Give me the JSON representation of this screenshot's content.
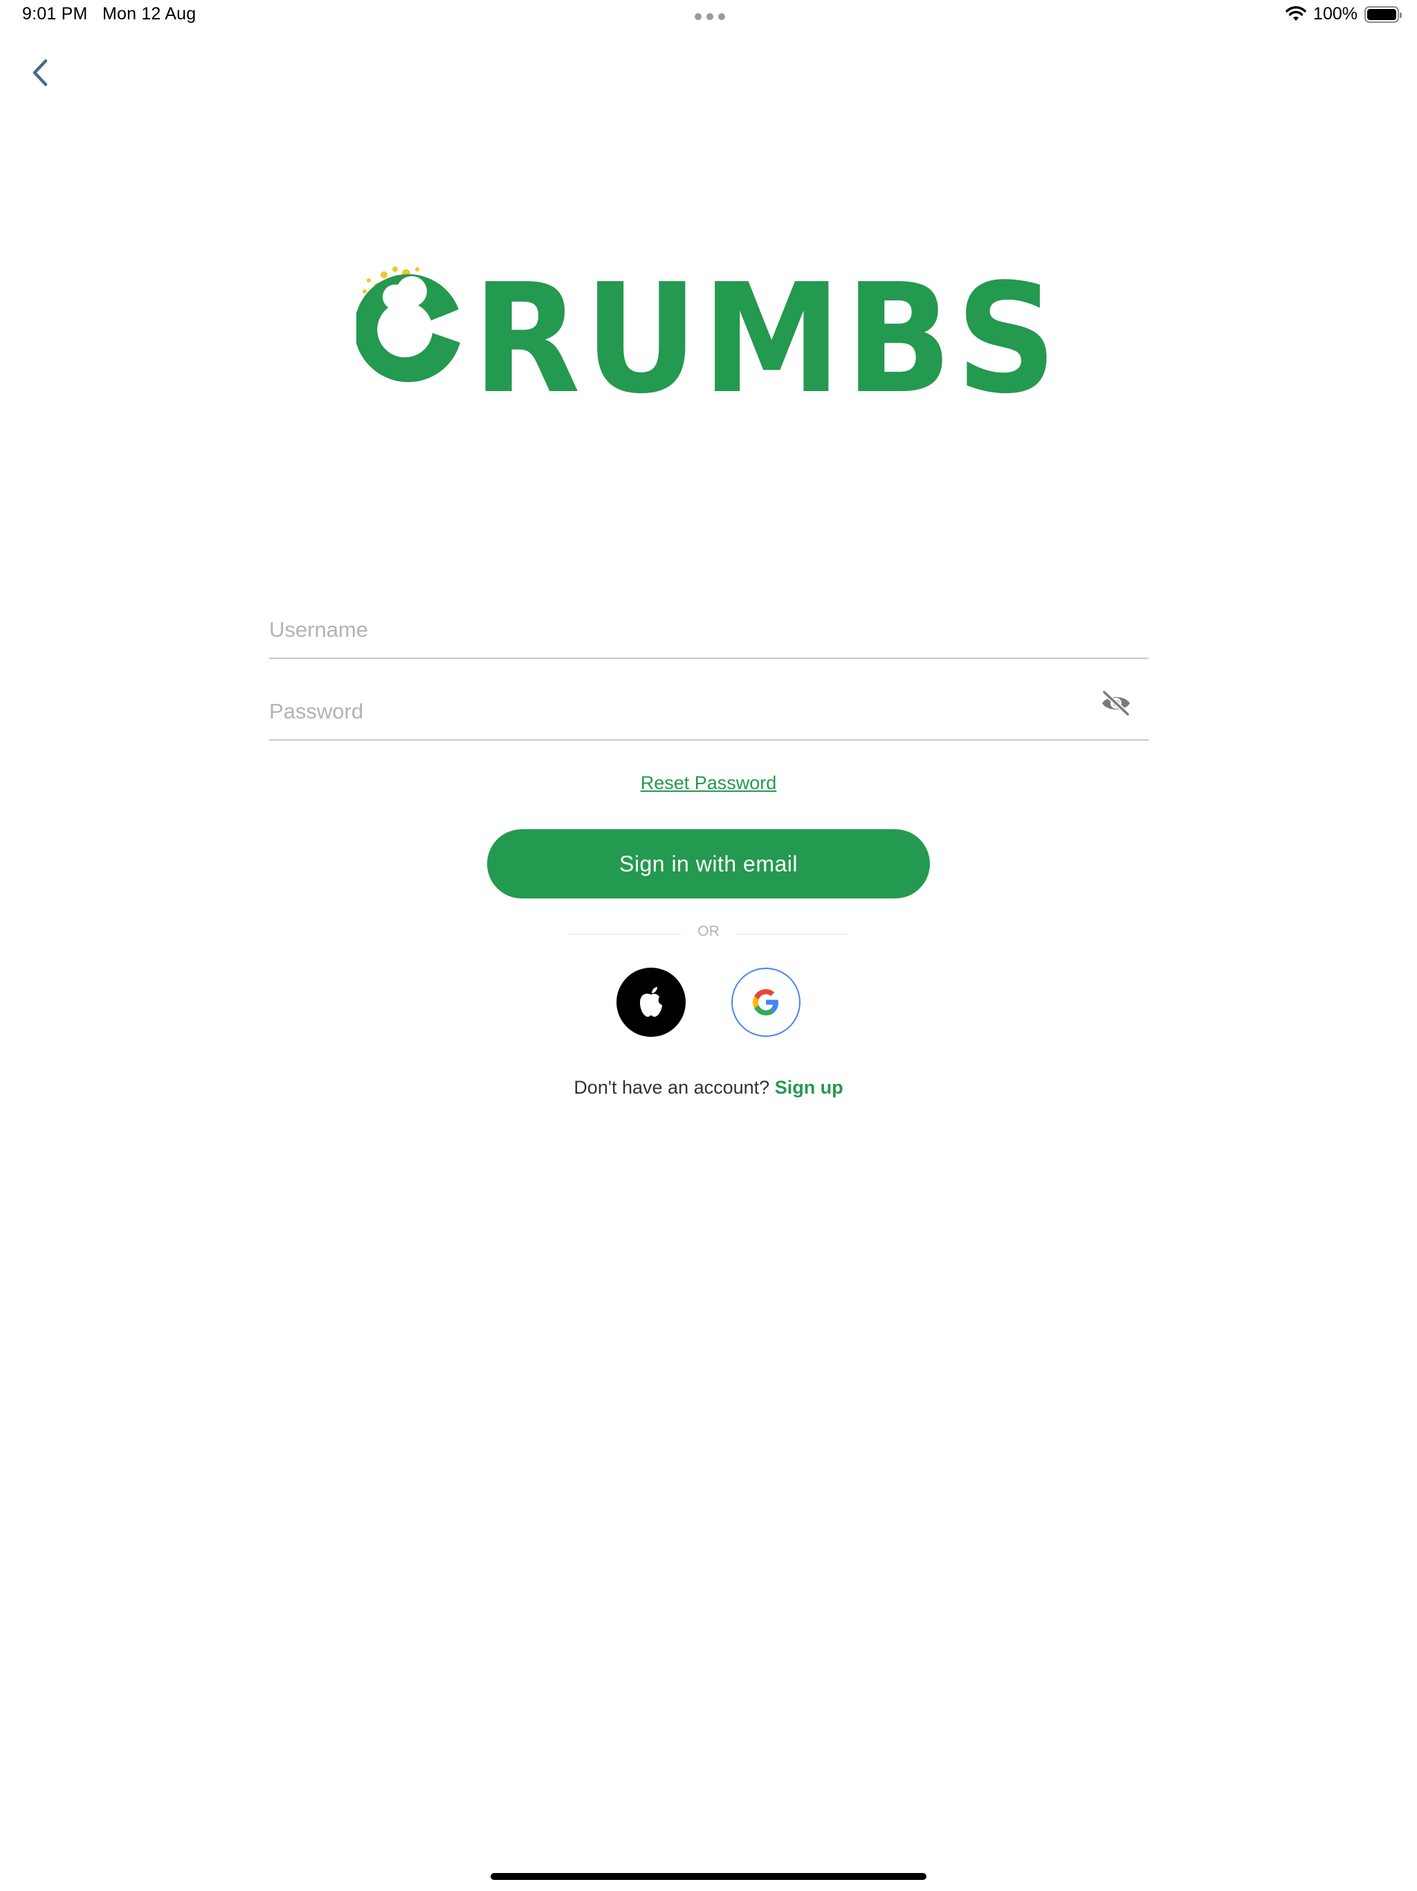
{
  "status_bar": {
    "time": "9:01 PM",
    "date": "Mon 12 Aug",
    "battery_percent": "100%",
    "battery_level": 1.0,
    "icons": [
      "wifi-icon",
      "battery-icon",
      "multitasking-dots-icon"
    ]
  },
  "nav": {
    "back_icon": "chevron-left-icon"
  },
  "logo": {
    "text": "CRUMBS",
    "brand_color": "#249950",
    "crumb_color": "#f4c430"
  },
  "form": {
    "username": {
      "value": "",
      "placeholder": "Username"
    },
    "password": {
      "value": "",
      "placeholder": "Password",
      "toggle_icon": "eye-off-icon"
    },
    "reset_password": "Reset Password",
    "signin_label": "Sign in with email",
    "or_label": "OR"
  },
  "social": {
    "apple_icon": "apple-icon",
    "google_icon": "google-icon"
  },
  "signup": {
    "prompt": "Don't have an account?",
    "link": "Sign up"
  },
  "colors": {
    "accent": "#249950",
    "placeholder": "#b3b3b3",
    "divider": "#c8c8c8",
    "google_border": "#4a86e8"
  }
}
